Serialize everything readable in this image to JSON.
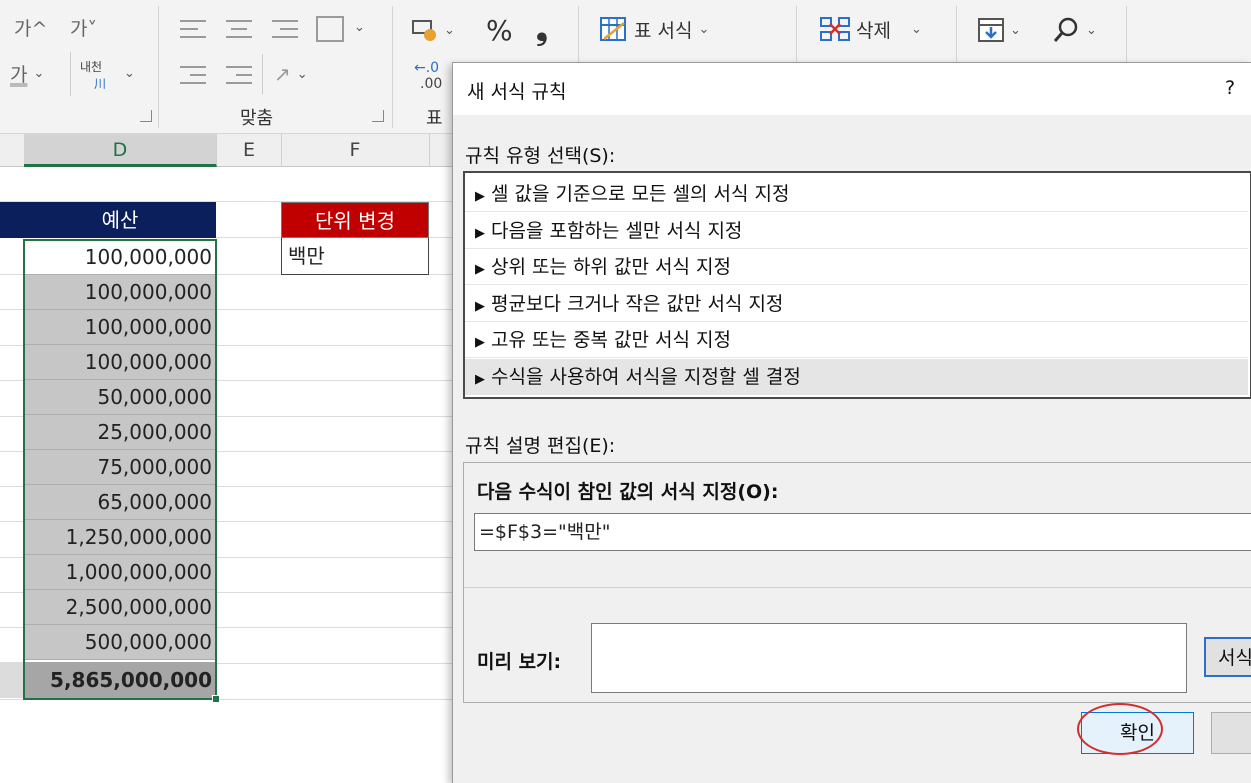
{
  "ribbon": {
    "font_grow": "가^",
    "font_shrink": "가˅",
    "font_color_glyph": "가",
    "wrap_text_top": "내천",
    "wrap_text_bottom": "川",
    "group_align": "맞춤",
    "group_number": "표",
    "percent": "%",
    "comma": "❟",
    "table_format": "표 서식",
    "delete": "삭제",
    "decimal_top": "←.0",
    "decimal_bottom": ".00"
  },
  "sheet": {
    "columns": [
      "D",
      "E",
      "F"
    ],
    "budget_header": "예산",
    "budget_values": [
      "100,000,000",
      "100,000,000",
      "100,000,000",
      "100,000,000",
      "50,000,000",
      "25,000,000",
      "75,000,000",
      "65,000,000",
      "1,250,000,000",
      "1,000,000,000",
      "2,500,000,000",
      "500,000,000"
    ],
    "budget_total": "5,865,000,000",
    "unit_header": "단위 변경",
    "unit_value": "백만"
  },
  "dialog": {
    "title": "새 서식 규칙",
    "help": "?",
    "rule_type_label": "규칙 유형 선택(S):",
    "rule_types": [
      "셀 값을 기준으로 모든 셀의 서식 지정",
      "다음을 포함하는 셀만 서식 지정",
      "상위 또는 하위 값만 서식 지정",
      "평균보다 크거나 작은 값만 서식 지정",
      "고유 또는 중복 값만 서식 지정",
      "수식을 사용하여 서식을 지정할 셀 결정"
    ],
    "edit_label": "규칙 설명 편집(E):",
    "formula_label": "다음 수식이 참인 값의 서식 지정(O):",
    "formula_value": "=$F$3=\"백만\"",
    "preview_label": "미리 보기:",
    "format_button": "서식",
    "ok_button": "확인"
  },
  "colors": {
    "header_navy": "#0a1f5c",
    "header_red": "#c00000",
    "selection_green": "#217346",
    "highlight_circle": "#d32f2f"
  }
}
